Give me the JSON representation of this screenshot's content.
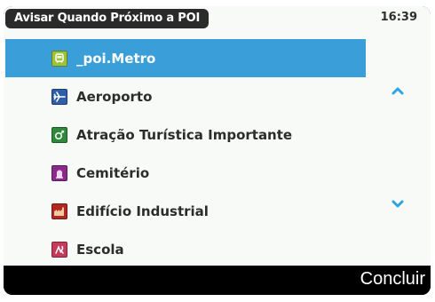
{
  "titlebar": {
    "title": "Avisar Quando Próximo a POI",
    "time": "16:39"
  },
  "list": {
    "items": [
      {
        "label": "_poi.Metro",
        "icon": "metro-icon",
        "icon_color": "#9cc43a",
        "selected": true
      },
      {
        "label": "Aeroporto",
        "icon": "airplane-icon",
        "icon_color": "#2e5fa8",
        "selected": false
      },
      {
        "label": "Atração Turística Importante",
        "icon": "tourist-attraction-icon",
        "icon_color": "#2e8a3a",
        "selected": false
      },
      {
        "label": "Cemitério",
        "icon": "cemetery-icon",
        "icon_color": "#8a2a8a",
        "selected": false
      },
      {
        "label": "Edifício Industrial",
        "icon": "industrial-building-icon",
        "icon_color": "#b0281f",
        "selected": false
      },
      {
        "label": "Escola",
        "icon": "school-icon",
        "icon_color": "#c43a5a",
        "selected": false
      }
    ]
  },
  "scroll": {
    "up_icon": "chevron-up-icon",
    "down_icon": "chevron-down-icon",
    "color": "#2aa6e0"
  },
  "softkeys": {
    "right": "Concluir"
  },
  "colors": {
    "selection": "#3a9fd8",
    "background": "#f7faf7",
    "bar": "#000000"
  }
}
